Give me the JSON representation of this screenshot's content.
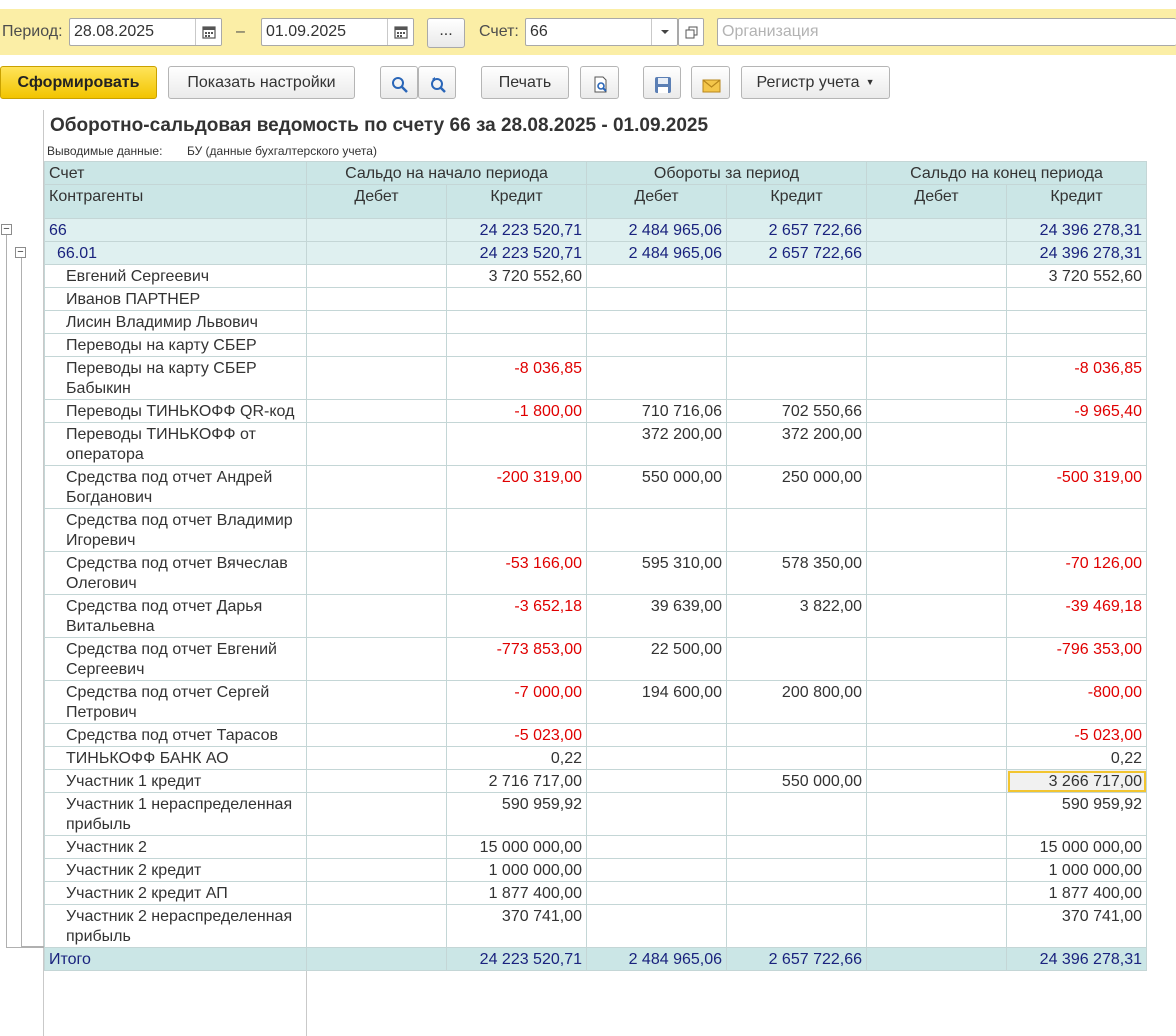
{
  "filter": {
    "period_label": "Период:",
    "date_from": "28.08.2025",
    "dash": "–",
    "date_to": "01.09.2025",
    "more_label": "...",
    "account_label": "Счет:",
    "account_value": "66",
    "org_placeholder": "Организация"
  },
  "toolbar": {
    "generate": "Сформировать",
    "show_settings": "Показать настройки",
    "print": "Печать",
    "register": "Регистр учета"
  },
  "colors": {
    "header_bg": "#cbe6e6",
    "group_bg": "#dff0f0",
    "negative": "#e00000",
    "accent": "#f2c400"
  },
  "report": {
    "title": "Оборотно-сальдовая ведомость по счету 66 за 28.08.2025 - 01.09.2025",
    "data_label": "Выводимые данные:",
    "data_value": "БУ (данные бухгалтерского учета)",
    "headers": {
      "account": "Счет",
      "counterparties": "Контрагенты",
      "opening": "Сальдо на начало периода",
      "turnover": "Обороты за период",
      "closing": "Сальдо на конец периода",
      "debit": "Дебет",
      "credit": "Кредит"
    },
    "rows": [
      {
        "name": "66",
        "type": "group",
        "level": 0,
        "open_d": "",
        "open_c": "24 223 520,71",
        "turn_d": "2 484 965,06",
        "turn_c": "2 657 722,66",
        "close_d": "",
        "close_c": "24 396 278,31"
      },
      {
        "name": "66.01",
        "type": "group",
        "level": 1,
        "open_d": "",
        "open_c": "24 223 520,71",
        "turn_d": "2 484 965,06",
        "turn_c": "2 657 722,66",
        "close_d": "",
        "close_c": "24 396 278,31"
      },
      {
        "name": "Евгений Сергеевич",
        "type": "item",
        "lines": 1,
        "open_d": "",
        "open_c": "3 720 552,60",
        "turn_d": "",
        "turn_c": "",
        "close_d": "",
        "close_c": "3 720 552,60"
      },
      {
        "name": "Иванов ПАРТНЕР",
        "type": "item",
        "lines": 1,
        "open_d": "",
        "open_c": "",
        "turn_d": "",
        "turn_c": "",
        "close_d": "",
        "close_c": ""
      },
      {
        "name": "Лисин Владимир Львович",
        "type": "item",
        "lines": 1,
        "open_d": "",
        "open_c": "",
        "turn_d": "",
        "turn_c": "",
        "close_d": "",
        "close_c": ""
      },
      {
        "name": "Переводы на карту СБЕР",
        "type": "item",
        "lines": 1,
        "open_d": "",
        "open_c": "",
        "turn_d": "",
        "turn_c": "",
        "close_d": "",
        "close_c": ""
      },
      {
        "name": "Переводы на карту СБЕР Бабыкин",
        "type": "item",
        "lines": 2,
        "open_d": "",
        "open_c": "-8 036,85",
        "turn_d": "",
        "turn_c": "",
        "close_d": "",
        "close_c": "-8 036,85"
      },
      {
        "name": "Переводы ТИНЬКОФФ QR-код",
        "type": "item",
        "lines": 1,
        "open_d": "",
        "open_c": "-1 800,00",
        "turn_d": "710 716,06",
        "turn_c": "702 550,66",
        "close_d": "",
        "close_c": "-9 965,40"
      },
      {
        "name": "Переводы ТИНЬКОФФ от оператора",
        "type": "item",
        "lines": 2,
        "open_d": "",
        "open_c": "",
        "turn_d": "372 200,00",
        "turn_c": "372 200,00",
        "close_d": "",
        "close_c": ""
      },
      {
        "name": "Средства под отчет Андрей Богданович",
        "type": "item",
        "lines": 2,
        "open_d": "",
        "open_c": "-200 319,00",
        "turn_d": "550 000,00",
        "turn_c": "250 000,00",
        "close_d": "",
        "close_c": "-500 319,00"
      },
      {
        "name": "Средства под отчет Владимир Игоревич",
        "type": "item",
        "lines": 2,
        "open_d": "",
        "open_c": "",
        "turn_d": "",
        "turn_c": "",
        "close_d": "",
        "close_c": ""
      },
      {
        "name": "Средства под отчет Вячеслав Олегович",
        "type": "item",
        "lines": 2,
        "open_d": "",
        "open_c": "-53 166,00",
        "turn_d": "595 310,00",
        "turn_c": "578 350,00",
        "close_d": "",
        "close_c": "-70 126,00"
      },
      {
        "name": "Средства под отчет Дарья Витальевна",
        "type": "item",
        "lines": 2,
        "open_d": "",
        "open_c": "-3 652,18",
        "turn_d": "39 639,00",
        "turn_c": "3 822,00",
        "close_d": "",
        "close_c": "-39 469,18"
      },
      {
        "name": "Средства под отчет Евгений Сергеевич",
        "type": "item",
        "lines": 2,
        "open_d": "",
        "open_c": "-773 853,00",
        "turn_d": "22 500,00",
        "turn_c": "",
        "close_d": "",
        "close_c": "-796 353,00"
      },
      {
        "name": "Средства под отчет Сергей Петрович",
        "type": "item",
        "lines": 2,
        "open_d": "",
        "open_c": "-7 000,00",
        "turn_d": "194 600,00",
        "turn_c": "200 800,00",
        "close_d": "",
        "close_c": "-800,00"
      },
      {
        "name": "Средства под отчет Тарасов",
        "type": "item",
        "lines": 1,
        "open_d": "",
        "open_c": "-5 023,00",
        "turn_d": "",
        "turn_c": "",
        "close_d": "",
        "close_c": "-5 023,00"
      },
      {
        "name": "ТИНЬКОФФ БАНК АО",
        "type": "item",
        "lines": 1,
        "open_d": "",
        "open_c": "0,22",
        "turn_d": "",
        "turn_c": "",
        "close_d": "",
        "close_c": "0,22"
      },
      {
        "name": "Участник 1 кредит",
        "type": "item",
        "lines": 1,
        "open_d": "",
        "open_c": "2 716 717,00",
        "turn_d": "",
        "turn_c": "550 000,00",
        "close_d": "",
        "close_c": "3 266 717,00",
        "selected": "close_c"
      },
      {
        "name": "Участник 1 нераспределенная прибыль",
        "type": "item",
        "lines": 2,
        "open_d": "",
        "open_c": "590 959,92",
        "turn_d": "",
        "turn_c": "",
        "close_d": "",
        "close_c": "590 959,92"
      },
      {
        "name": "Участник 2",
        "type": "item",
        "lines": 1,
        "open_d": "",
        "open_c": "15 000 000,00",
        "turn_d": "",
        "turn_c": "",
        "close_d": "",
        "close_c": "15 000 000,00"
      },
      {
        "name": "Участник 2 кредит",
        "type": "item",
        "lines": 1,
        "open_d": "",
        "open_c": "1 000 000,00",
        "turn_d": "",
        "turn_c": "",
        "close_d": "",
        "close_c": "1 000 000,00"
      },
      {
        "name": "Участник 2 кредит АП",
        "type": "item",
        "lines": 1,
        "open_d": "",
        "open_c": "1 877 400,00",
        "turn_d": "",
        "turn_c": "",
        "close_d": "",
        "close_c": "1 877 400,00"
      },
      {
        "name": "Участник 2 нераспределенная прибыль",
        "type": "item",
        "lines": 2,
        "open_d": "",
        "open_c": "370 741,00",
        "turn_d": "",
        "turn_c": "",
        "close_d": "",
        "close_c": "370 741,00"
      }
    ],
    "total": {
      "name": "Итого",
      "open_d": "",
      "open_c": "24 223 520,71",
      "turn_d": "2 484 965,06",
      "turn_c": "2 657 722,66",
      "close_d": "",
      "close_c": "24 396 278,31"
    }
  }
}
